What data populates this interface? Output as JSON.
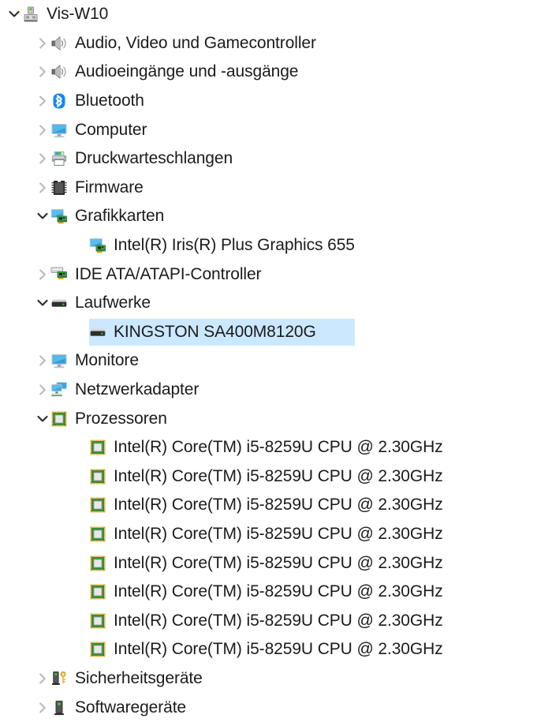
{
  "app": {
    "title": "Geraete-Manager",
    "selection_color": "#cce8ff",
    "text_color": "#1b1b1b"
  },
  "tree": {
    "nodes": [
      {
        "label": "Vis-W10",
        "level": 0,
        "expander": "expanded",
        "icon": "computer-tower-icon",
        "selected": false
      },
      {
        "label": "Audio, Video und Gamecontroller",
        "level": 1,
        "expander": "collapsed",
        "icon": "speaker-icon",
        "selected": false
      },
      {
        "label": "Audioeingänge und -ausgänge",
        "level": 1,
        "expander": "collapsed",
        "icon": "speaker-icon",
        "selected": false
      },
      {
        "label": "Bluetooth",
        "level": 1,
        "expander": "collapsed",
        "icon": "bluetooth-icon",
        "selected": false
      },
      {
        "label": "Computer",
        "level": 1,
        "expander": "collapsed",
        "icon": "monitor-icon",
        "selected": false
      },
      {
        "label": "Druckwarteschlangen",
        "level": 1,
        "expander": "collapsed",
        "icon": "printer-icon",
        "selected": false
      },
      {
        "label": "Firmware",
        "level": 1,
        "expander": "collapsed",
        "icon": "memory-chip-icon",
        "selected": false
      },
      {
        "label": "Grafikkarten",
        "level": 1,
        "expander": "expanded",
        "icon": "display-adapter-icon",
        "selected": false
      },
      {
        "label": "Intel(R) Iris(R) Plus Graphics 655",
        "level": 2,
        "expander": "none",
        "icon": "display-adapter-icon",
        "selected": false
      },
      {
        "label": "IDE ATA/ATAPI-Controller",
        "level": 1,
        "expander": "collapsed",
        "icon": "ide-controller-icon",
        "selected": false
      },
      {
        "label": "Laufwerke",
        "level": 1,
        "expander": "expanded",
        "icon": "disk-drive-icon",
        "selected": false
      },
      {
        "label": "KINGSTON SA400M8120G",
        "level": 2,
        "expander": "none",
        "icon": "disk-drive-icon",
        "selected": true
      },
      {
        "label": "Monitore",
        "level": 1,
        "expander": "collapsed",
        "icon": "monitor-icon",
        "selected": false
      },
      {
        "label": "Netzwerkadapter",
        "level": 1,
        "expander": "collapsed",
        "icon": "network-adapter-icon",
        "selected": false
      },
      {
        "label": "Prozessoren",
        "level": 1,
        "expander": "expanded",
        "icon": "cpu-icon",
        "selected": false
      },
      {
        "label": "Intel(R) Core(TM) i5-8259U CPU @ 2.30GHz",
        "level": 2,
        "expander": "none",
        "icon": "cpu-icon",
        "selected": false
      },
      {
        "label": "Intel(R) Core(TM) i5-8259U CPU @ 2.30GHz",
        "level": 2,
        "expander": "none",
        "icon": "cpu-icon",
        "selected": false
      },
      {
        "label": "Intel(R) Core(TM) i5-8259U CPU @ 2.30GHz",
        "level": 2,
        "expander": "none",
        "icon": "cpu-icon",
        "selected": false
      },
      {
        "label": "Intel(R) Core(TM) i5-8259U CPU @ 2.30GHz",
        "level": 2,
        "expander": "none",
        "icon": "cpu-icon",
        "selected": false
      },
      {
        "label": "Intel(R) Core(TM) i5-8259U CPU @ 2.30GHz",
        "level": 2,
        "expander": "none",
        "icon": "cpu-icon",
        "selected": false
      },
      {
        "label": "Intel(R) Core(TM) i5-8259U CPU @ 2.30GHz",
        "level": 2,
        "expander": "none",
        "icon": "cpu-icon",
        "selected": false
      },
      {
        "label": "Intel(R) Core(TM) i5-8259U CPU @ 2.30GHz",
        "level": 2,
        "expander": "none",
        "icon": "cpu-icon",
        "selected": false
      },
      {
        "label": "Intel(R) Core(TM) i5-8259U CPU @ 2.30GHz",
        "level": 2,
        "expander": "none",
        "icon": "cpu-icon",
        "selected": false
      },
      {
        "label": "Sicherheitsgeräte",
        "level": 1,
        "expander": "collapsed",
        "icon": "security-device-icon",
        "selected": false
      },
      {
        "label": "Softwaregeräte",
        "level": 1,
        "expander": "collapsed",
        "icon": "software-device-icon",
        "selected": false
      }
    ]
  }
}
